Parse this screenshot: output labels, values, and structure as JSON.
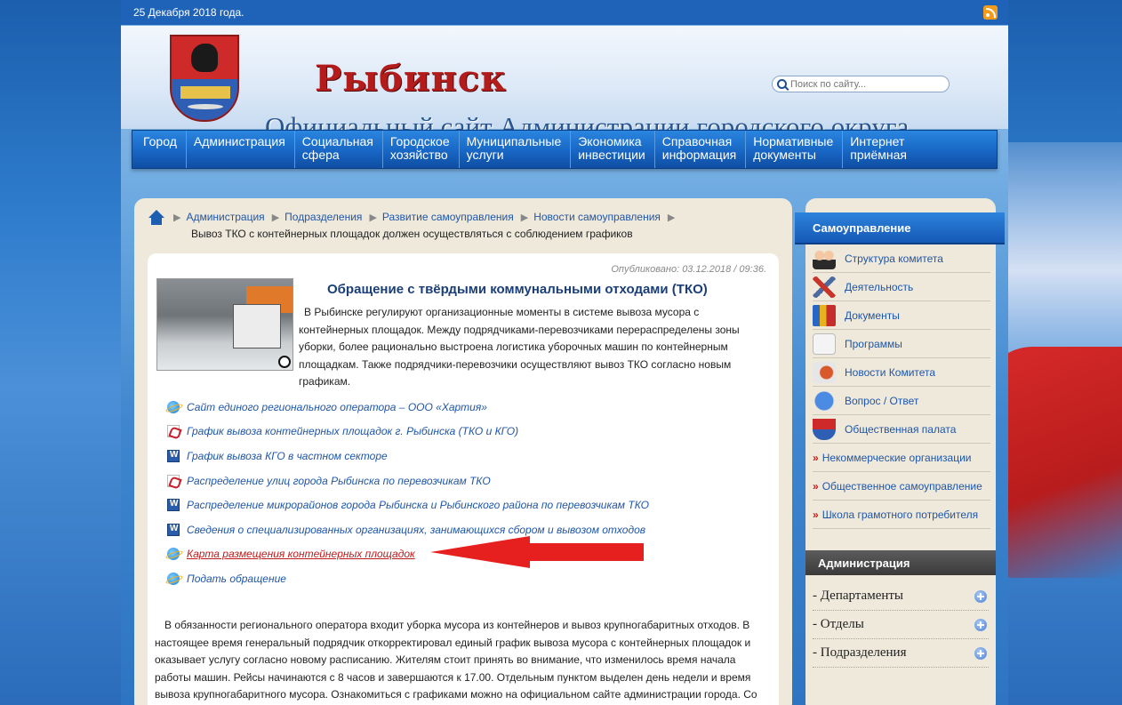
{
  "date": "25 Декабря 2018 года.",
  "header": {
    "city": "Рыбинск",
    "subtitle": "Официальный сайт Администрации городского округа",
    "search_placeholder": "Поиск по сайту..."
  },
  "menu": [
    {
      "label": "Город"
    },
    {
      "label": "Администрация"
    },
    {
      "label": "Социальная\nсфера"
    },
    {
      "label": "Городское\nхозяйство"
    },
    {
      "label": "Муниципальные\nуслуги"
    },
    {
      "label": "Экономика\nинвестиции"
    },
    {
      "label": "Справочная\nинформация"
    },
    {
      "label": "Нормативные\nдокументы"
    },
    {
      "label": "Интернет\nприёмная"
    }
  ],
  "breadcrumb": {
    "items": [
      "Администрация",
      "Подразделения",
      "Развитие самоуправления",
      "Новости самоуправления"
    ],
    "current": "Вывоз ТКО с контейнерных площадок должен осуществляться с соблюдением графиков"
  },
  "article": {
    "published": "Опубликовано: 03.12.2018 / 09:36.",
    "title": "Обращение с твёрдыми коммунальными отходами (ТКО)",
    "lead": "В Рыбинске регулируют организационные моменты в системе вывоза мусора с контейнерных площадок. Между подрядчиками-перевозчиками перераспределены зоны уборки, более рационально выстроена логистика уборочных машин по контейнерным площадкам. Также подрядчики-перевозчики осуществляют вывоз ТКО согласно новым графикам.",
    "links": [
      {
        "icon": "ie",
        "text": "Сайт единого регионального оператора – ООО «Хартия»"
      },
      {
        "icon": "pdf",
        "text": "График вывоза контейнерных площадок г. Рыбинска (ТКО и КГО)"
      },
      {
        "icon": "doc",
        "text": "График вывоза КГО в частном секторе"
      },
      {
        "icon": "pdf",
        "text": "Распределение улиц города Рыбинска по перевозчикам ТКО"
      },
      {
        "icon": "doc",
        "text": "Распределение микрорайонов города Рыбинска и Рыбинского района по перевозчикам ТКО"
      },
      {
        "icon": "doc",
        "text": "Сведения о специализированных организациях, занимающихся сбором и вывозом отходов"
      },
      {
        "icon": "ie",
        "text": "Карта размещения контейнерных площадок",
        "highlighted": true
      },
      {
        "icon": "ie",
        "text": "Подать обращение"
      }
    ],
    "body": "В обязанности регионального оператора входит уборка мусора из контейнеров и вывоз крупногабаритных отходов. В настоящее время генеральный подрядчик откорректировал единый график вывоза мусора с контейнерных площадок и оказывает услугу согласно новому расписанию. Жителям стоит принять во внимание, что изменилось время начала работы машин. Рейсы начинаются с 8 часов и завершаются к 17.00. Отдельным пунктом выделен день недели и время вывоза крупногабаритного мусора. Ознакомиться с графиками можно на официальном сайте администрации города. Со"
  },
  "sidebar": {
    "title": "Самоуправление",
    "items": [
      {
        "icon": "people-icon",
        "label": "Структура комитета"
      },
      {
        "icon": "tools-icon",
        "label": "Деятельность"
      },
      {
        "icon": "books-icon",
        "label": "Документы"
      },
      {
        "icon": "program-icon",
        "label": "Программы"
      },
      {
        "icon": "news-icon",
        "label": "Новости Комитета"
      },
      {
        "icon": "question-icon",
        "label": "Вопрос / Ответ"
      },
      {
        "icon": "coat-of-arms-icon",
        "label": "Общественная палата"
      }
    ],
    "links": [
      {
        "label": "Некоммерческие организации"
      },
      {
        "label": "Общественное самоуправление"
      },
      {
        "label": "Школа грамотного потребителя"
      }
    ],
    "admin_title": "Администрация",
    "admin_items": [
      {
        "label": "- Департаменты"
      },
      {
        "label": "- Отделы"
      },
      {
        "label": "- Подразделения"
      }
    ]
  },
  "colors": {
    "accent": "#1f56a8",
    "highlight_link": "#c01b1b",
    "arrow": "#e5201f"
  }
}
